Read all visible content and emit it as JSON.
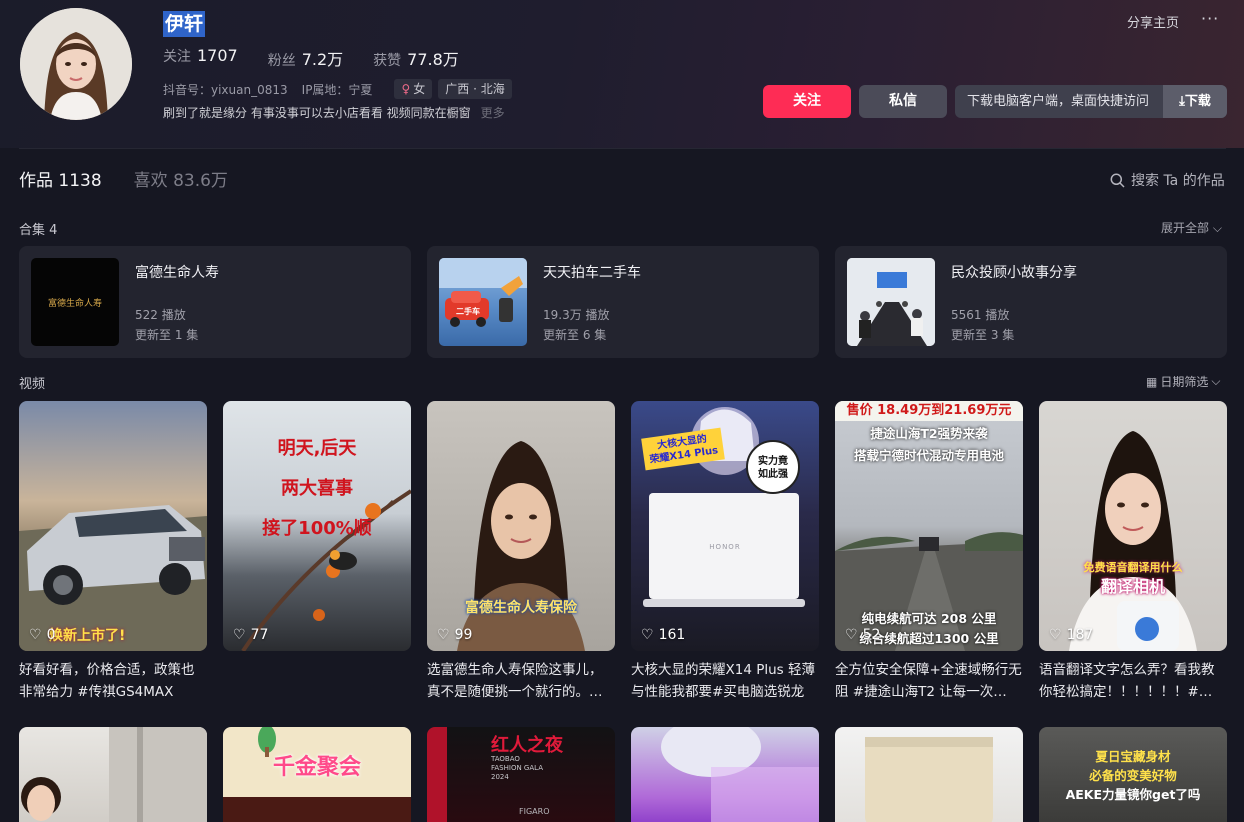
{
  "profile": {
    "nickname": "伊轩",
    "following_label": "关注",
    "following_count": "1707",
    "fans_label": "粉丝",
    "fans_count": "7.2万",
    "likes_label": "获赞",
    "likes_count": "77.8万",
    "douyin_id": "抖音号：yixuan_0813",
    "ip_location": "IP属地：宁夏",
    "gender_tag": "女",
    "region_tag": "广西 · 北海",
    "signature": "刷到了就是缘分 有事没事可以去小店看看 视频同款在橱窗",
    "more_label": "更多",
    "share_label": "分享主页",
    "more_dots": "···",
    "follow_button": "关注",
    "message_button": "私信",
    "download_text": "下载电脑客户端，桌面快捷访问",
    "download_button": "下载"
  },
  "tabs": {
    "works_label": "作品 1138",
    "likes_label": "喜欢 83.6万",
    "search_label": "搜索 Ta 的作品"
  },
  "collections": {
    "label": "合集 4",
    "expand_label": "展开全部",
    "items": [
      {
        "title": "富德生命人寿",
        "plays": "522 播放",
        "update": "更新至 1 集",
        "thumb_text": "富德生命人寿"
      },
      {
        "title": "天天拍车二手车",
        "plays": "19.3万 播放",
        "update": "更新至 6 集",
        "thumb_text": "二手车"
      },
      {
        "title": "民众投顾小故事分享",
        "plays": "5561 播放",
        "update": "更新至 3 集",
        "thumb_text": ""
      }
    ]
  },
  "videos": {
    "label": "视频",
    "date_filter": "日期筛选",
    "items": [
      {
        "likes": "0",
        "caption": "好看好看，价格合适，政策也非常给力 #传祺GS4MAX",
        "overlay": "焕新上市了!"
      },
      {
        "likes": "77",
        "caption": "",
        "overlay": "明天,后天|两大喜事|接了100%顺"
      },
      {
        "likes": "99",
        "caption": "选富德生命人寿保险这事儿，真不是随便挑一个就行的。…",
        "overlay": "富德生命人寿保险"
      },
      {
        "likes": "161",
        "caption": "大核大显的荣耀X14 Plus 轻薄与性能我都要#买电脑选锐龙",
        "overlay": "大核大显的荣耀X14 Plus|实力竟如此强|HONOR"
      },
      {
        "likes": "52",
        "caption": "全方位安全保障+全速域畅行无阻 #捷途山海T2 让每一次…",
        "overlay": "售价 18.49万到21.69万元|捷途山海T2强势来袭|搭载宁德时代混动专用电池|纯电续航可达 208 公里|综合续航超过1300 公里"
      },
      {
        "likes": "187",
        "caption": "语音翻译文字怎么弄？看我教你轻松搞定！！！！！！#…",
        "overlay": "免费语音翻译用什么|翻译相机"
      }
    ],
    "row2_overlays": [
      "",
      "千金聚会",
      "红人之夜|TAOBAO FASHION GALA 2024|FIGARO",
      "",
      "",
      "夏日宝藏身材|必备的变美好物|AEKE力量镜你get了吗"
    ]
  },
  "colors": {
    "accent": "#fe2c55",
    "background": "#161722",
    "highlight": "#2f64c9"
  }
}
